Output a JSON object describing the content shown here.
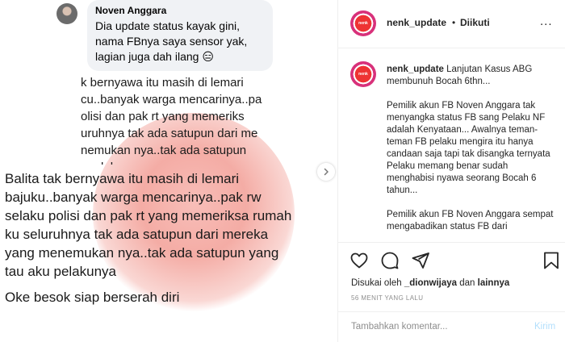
{
  "post_image": {
    "comment": {
      "author": "Noven Anggara",
      "text": "Dia update status kayak gini, nama FBnya saya sensor yak, lagian juga dah ilang 😑"
    },
    "screenshot_lines": "k bernyawa itu masih di lemari\ncu..banyak warga mencarinya..pak\nolisi dan pak rt yang memeriks\nuruhnya tak ada satupun dari me\nnemukan nya..tak ada satupun\n  pelakunya",
    "main_lines": "Balita tak bernyawa itu masih di lemari\nbajuku..banyak warga mencarinya..pak rw\nselaku polisi dan pak rt yang memeriksa rumah\nku seluruhnya tak ada satupun dari mereka\nyang menemukan nya..tak ada satupun yang\ntau aku pelakunya",
    "footer_line": "Oke besok siap berserah diri",
    "next_icon": "chevron-right-icon"
  },
  "header": {
    "username": "nenk_update",
    "dot": "•",
    "follow_status": "Diikuti",
    "more_icon": "ellipsis-icon",
    "more_label": "..."
  },
  "caption": {
    "username": "nenk_update",
    "intro": "Lanjutan Kasus ABG membunuh Bocah 6thn...",
    "para1": "Pemilik akun FB Noven Anggara tak menyangka status FB sang Pelaku NF adalah Kenyataan... Awalnya teman-teman FB pelaku mengira itu hanya candaan saja tapi tak disangka ternyata Pelaku memang benar sudah menghabisi nyawa seorang Bocah 6 tahun...",
    "para2": "Pemilik akun FB Noven Anggara sempat mengabadikan status FB dari"
  },
  "actions": {
    "icons": [
      "heart-icon",
      "comment-icon",
      "share-icon",
      "bookmark-icon"
    ],
    "liked_prefix": "Disukai oleh",
    "liked_user": "_dionwijaya",
    "liked_and": "dan",
    "liked_others": "lainnya",
    "time_ago": "56 MENIT YANG LALU"
  },
  "comment_bar": {
    "placeholder": "Tambahkan komentar...",
    "post_label": "Kirim"
  },
  "colors": {
    "accent_disabled": "#b2dffc",
    "secondary_text": "#8e8e8e",
    "divider": "#efefef"
  }
}
